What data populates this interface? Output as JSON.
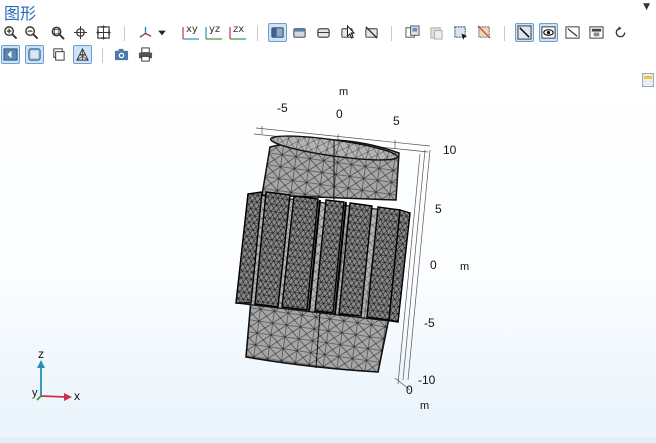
{
  "window": {
    "title": "图形"
  },
  "toolbar": {
    "axis_xy": "xy",
    "axis_yz": "yz",
    "axis_zx": "zx"
  },
  "axes": {
    "top_unit": "m",
    "top_ticks": [
      "-5",
      "0",
      "5"
    ],
    "right_ticks": [
      "10",
      "5",
      "0",
      "-5",
      "-10"
    ],
    "right_unit": "m",
    "bottom_tick": "0",
    "bottom_unit": "m"
  },
  "triad": {
    "z": "z",
    "y": "y",
    "x": "x"
  },
  "colors": {
    "accent": "#2b6cb8",
    "mesh_fill": "#a9a9a9",
    "mesh_line": "#222222",
    "triad_x": "#d0304a",
    "triad_yz": "#2a8fb8"
  }
}
